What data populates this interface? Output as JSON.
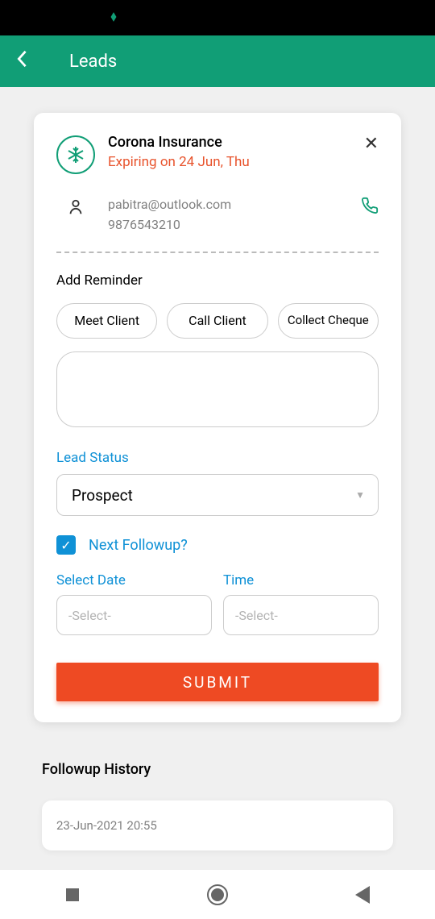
{
  "header": {
    "title": "Leads"
  },
  "lead": {
    "title": "Corona Insurance",
    "expiry": "Expiring on 24 Jun, Thu",
    "email": "pabitra@outlook.com",
    "phone": "9876543210"
  },
  "reminder": {
    "section_label": "Add Reminder",
    "options": {
      "meet": "Meet Client",
      "call": "Call Client",
      "collect": "Collect Cheque"
    }
  },
  "status": {
    "label": "Lead Status",
    "selected": "Prospect"
  },
  "followup": {
    "label": "Next Followup?",
    "date_label": "Select Date",
    "time_label": "Time",
    "date_placeholder": "-Select-",
    "time_placeholder": "-Select-"
  },
  "submit_label": "SUBMIT",
  "history": {
    "title": "Followup History",
    "items": [
      {
        "timestamp": "23-Jun-2021 20:55"
      }
    ]
  }
}
